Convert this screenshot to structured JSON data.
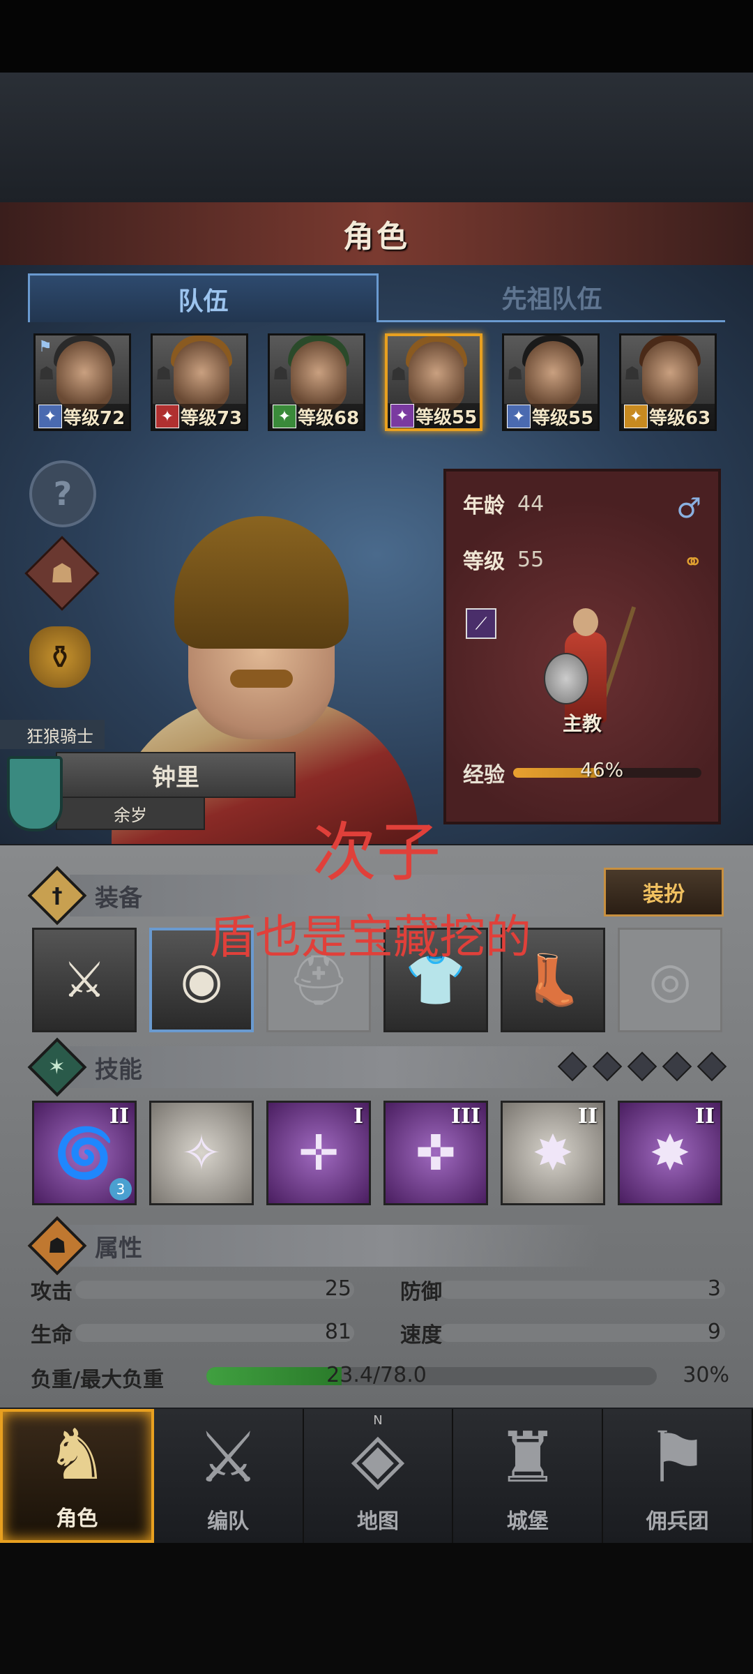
{
  "header": {
    "title": "角色"
  },
  "tabs": [
    {
      "label": "队伍",
      "active": true
    },
    {
      "label": "先祖队伍",
      "active": false
    }
  ],
  "roster": [
    {
      "level_text": "等级72",
      "class_icon": "sword-icon",
      "class_color": "#4a6ab0",
      "hair": "#2a2a2a",
      "leader_flag": true
    },
    {
      "level_text": "等级73",
      "class_icon": "house-icon",
      "class_color": "#b03030",
      "hair": "#8a5a20"
    },
    {
      "level_text": "等级68",
      "class_icon": "crossed-swords-icon",
      "class_color": "#3a8a3a",
      "hair": "#2a4a2a"
    },
    {
      "level_text": "等级55",
      "class_icon": "staff-icon",
      "class_color": "#7a3aa0",
      "hair": "#8a5a20",
      "selected": true
    },
    {
      "level_text": "等级55",
      "class_icon": "sword-icon",
      "class_color": "#4a6ab0",
      "hair": "#1a1a1a"
    },
    {
      "level_text": "等级63",
      "class_icon": "shield-icon",
      "class_color": "#c88a20",
      "hair": "#4a2a18"
    }
  ],
  "character": {
    "title": "狂狼骑士",
    "name": "钟里",
    "age_text": "余岁",
    "age_label": "年龄",
    "age": "44",
    "level_label": "等级",
    "level": "55",
    "class_name": "主教",
    "exp_label": "经验",
    "exp_percent": 46,
    "exp_percent_text": "46%",
    "gender_icon": "male-icon",
    "rings_icon": "rings-icon"
  },
  "overlay": {
    "line1": "次子",
    "line2": "盾也是宝藏挖的"
  },
  "equipment": {
    "title": "装备",
    "outfit_button": "装扮",
    "slots": [
      {
        "icon": "spear-icon",
        "glyph": "⚔",
        "empty": false,
        "selected": false
      },
      {
        "icon": "round-shield-icon",
        "glyph": "◉",
        "empty": false,
        "selected": true
      },
      {
        "icon": "helmet-icon",
        "glyph": "⛑",
        "empty": true
      },
      {
        "icon": "armor-icon",
        "glyph": "👕",
        "empty": false
      },
      {
        "icon": "boots-icon",
        "glyph": "👢",
        "empty": false
      },
      {
        "icon": "ring-icon",
        "glyph": "◎",
        "empty": true
      }
    ]
  },
  "skills": {
    "title": "技能",
    "slots": [
      {
        "icon": "whirlwind-icon",
        "glyph": "🌀",
        "rank": "II",
        "badge": "3",
        "style": "purple"
      },
      {
        "icon": "crystal-summon-icon",
        "glyph": "✧",
        "rank": "",
        "style": "light"
      },
      {
        "icon": "target-spear-icon",
        "glyph": "✛",
        "rank": "I",
        "style": "purple"
      },
      {
        "icon": "crosshair-icon",
        "glyph": "✜",
        "rank": "III",
        "style": "purple"
      },
      {
        "icon": "burst-icon",
        "glyph": "✸",
        "rank": "II",
        "style": "light"
      },
      {
        "icon": "burst-icon",
        "glyph": "✸",
        "rank": "II",
        "style": "purple"
      }
    ]
  },
  "attributes": {
    "title": "属性",
    "attack_label": "攻击",
    "attack": "25",
    "defense_label": "防御",
    "defense": "3",
    "hp_label": "生命",
    "hp": "81",
    "speed_label": "速度",
    "speed": "9",
    "weight_label": "负重/最大负重",
    "weight_text": "23.4/78.0",
    "weight_percent": 30,
    "weight_percent_text": "30%"
  },
  "nav": [
    {
      "label": "角色",
      "icon": "knight-icon",
      "glyph": "♞",
      "active": true
    },
    {
      "label": "编队",
      "icon": "team-icon",
      "glyph": "⚔",
      "active": false
    },
    {
      "label": "地图",
      "icon": "compass-map-icon",
      "glyph": "◈",
      "active": false,
      "compass": "N"
    },
    {
      "label": "城堡",
      "icon": "castle-icon",
      "glyph": "♜",
      "active": false
    },
    {
      "label": "佣兵团",
      "icon": "mercenary-icon",
      "glyph": "⚑",
      "active": false
    }
  ]
}
